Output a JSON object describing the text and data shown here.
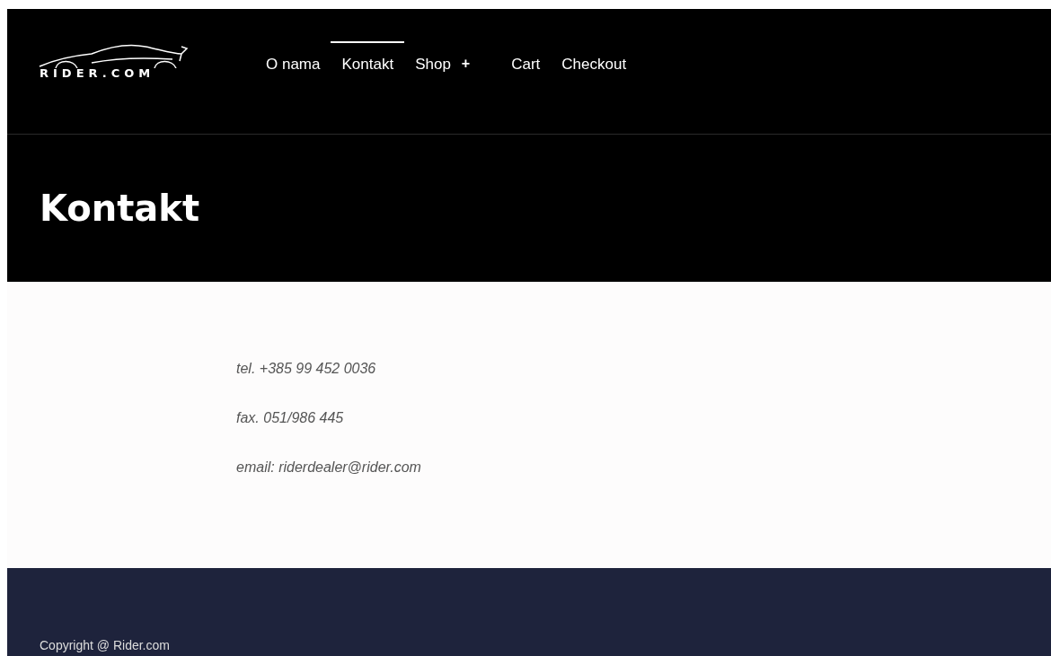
{
  "logo": {
    "text": "RIDER.COM"
  },
  "nav": [
    {
      "label": "O nama",
      "selected": false
    },
    {
      "label": "Kontakt",
      "selected": true
    },
    {
      "label": "Shop",
      "selected": false,
      "suffix": "+"
    },
    {
      "label": "Cart",
      "selected": false
    },
    {
      "label": "Checkout",
      "selected": false
    }
  ],
  "page_title": "Kontakt",
  "contact_lines": [
    "tel. +385 99 452 0036",
    "fax. 051/986 445",
    "email: riderdealer@rider.com"
  ],
  "footer": {
    "copyright": "Copyright @ Rider.com"
  }
}
